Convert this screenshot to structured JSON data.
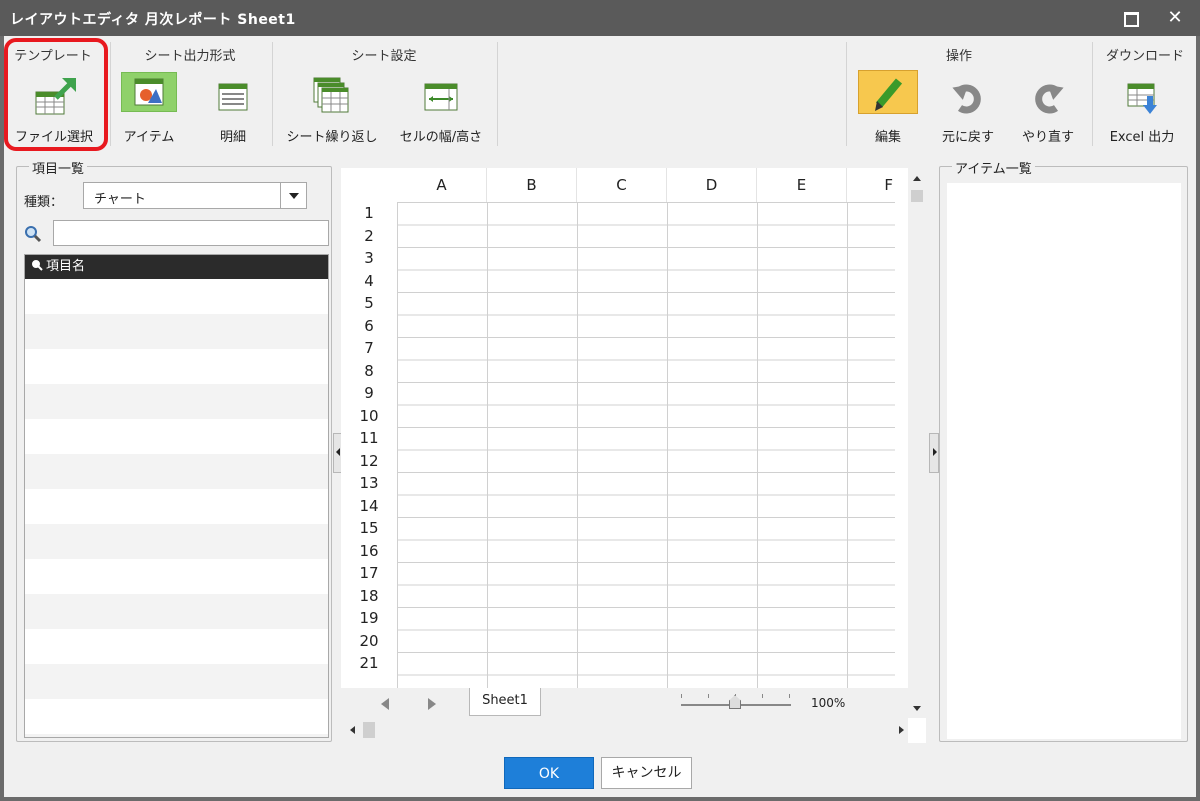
{
  "title": "レイアウトエディタ 月次レポート Sheet1",
  "window_controls": {
    "close": "✕"
  },
  "ribbon": {
    "groups": {
      "template": "テンプレート",
      "sheet_output": "シート出力形式",
      "sheet_settings": "シート設定",
      "operations": "操作",
      "download": "ダウンロード"
    },
    "buttons": {
      "file_select": "ファイル選択",
      "item": "アイテム",
      "detail": "明細",
      "sheet_repeat": "シート繰り返し",
      "cell_size": "セルの幅/高さ",
      "edit": "編集",
      "undo": "元に戻す",
      "redo": "やり直す",
      "excel_output": "Excel 出力"
    }
  },
  "left_panel": {
    "title": "項目一覧",
    "type_label": "種類：",
    "type_value": "チャート",
    "search_value": "",
    "list_header": "項目名"
  },
  "sheet": {
    "columns": [
      "A",
      "B",
      "C",
      "D",
      "E",
      "F"
    ],
    "rows": [
      "1",
      "2",
      "3",
      "4",
      "5",
      "6",
      "7",
      "8",
      "9",
      "10",
      "11",
      "12",
      "13",
      "14",
      "15",
      "16",
      "17",
      "18",
      "19",
      "20",
      "21"
    ],
    "tab": "Sheet1",
    "zoom": "100%",
    "zoom_level": 1.0
  },
  "right_panel": {
    "title": "アイテム一覧"
  },
  "footer": {
    "ok": "OK",
    "cancel": "キャンセル"
  },
  "colors": {
    "accent": "#1e7fd9",
    "highlight": "#e8191f",
    "selected": "#8fd16a",
    "edit": "#f7c84e"
  }
}
